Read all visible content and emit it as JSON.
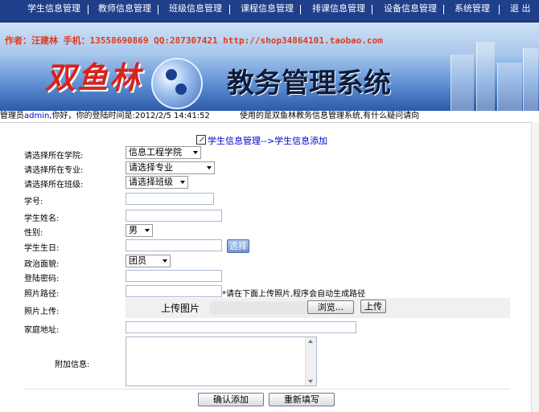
{
  "nav": {
    "items": [
      "学生信息管理",
      "教师信息管理",
      "班级信息管理",
      "课程信息管理",
      "排课信息管理",
      "设备信息管理",
      "系统管理",
      "退 出"
    ]
  },
  "banner": {
    "author_line": "作者：汪建林  手机：13558690869  QQ:287307421  http://shop34864101.taobao.com",
    "logo": "双鱼林",
    "system_title": "教务管理系统"
  },
  "status": {
    "prefix": "管理员",
    "user": "admin",
    "greeting": ",你好，你的登陆时间是:2012/2/5 14:41:52",
    "message": "使用的是双鱼林教务信息管理系统,有什么疑问请向"
  },
  "breadcrumb": "学生信息管理-->学生信息添加",
  "form": {
    "college_label": "请选择所在学院:",
    "college_value": "信息工程学院",
    "major_label": "请选择所在专业:",
    "major_value": "请选择专业",
    "class_label": "请选择所在班级:",
    "class_value": "请选择班级",
    "number_label": "学号:",
    "name_label": "学生姓名:",
    "sex_label": "性别:",
    "sex_value": "男",
    "birthday_label": "学生生日:",
    "birthday_button": "选择",
    "politics_label": "政治面貌:",
    "politics_value": "团员",
    "password_label": "登陆密码:",
    "photo_path_label": "照片路径:",
    "photo_path_note": "*请在下面上传照片,程序会自动生成路径",
    "photo_upload_label": "照片上传:",
    "upload_title": "上传图片",
    "browse_button": "浏览...",
    "upload_button": "上传",
    "address_label": "家庭地址:",
    "extra_label": "附加信息:",
    "submit_button": "确认添加",
    "reset_button": "重新填写"
  }
}
